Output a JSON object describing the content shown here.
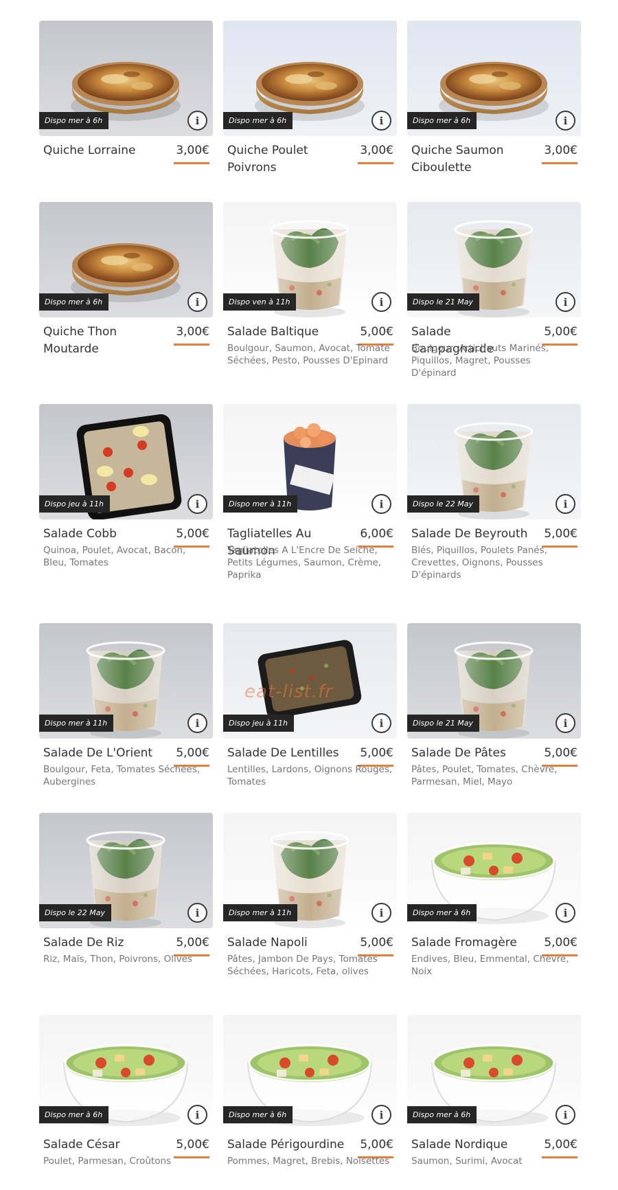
{
  "accent_color": "#e0803d",
  "info_icon": "info-circle-icon",
  "watermark": "eat-list.fr",
  "products": [
    {
      "badge": "Dispo mer à 6h",
      "name": "Quiche Lorraine",
      "price": "3,00€",
      "desc": ""
    },
    {
      "badge": "Dispo mer à 6h",
      "name": "Quiche Poulet Poivrons",
      "price": "3,00€",
      "desc": ""
    },
    {
      "badge": "Dispo mer à 6h",
      "name": "Quiche Saumon Ciboulette",
      "price": "3,00€",
      "desc": ""
    },
    {
      "badge": "Dispo mer à 6h",
      "name": "Quiche Thon Moutarde",
      "price": "3,00€",
      "desc": ""
    },
    {
      "badge": "Dispo ven à 11h",
      "name": "Salade Baltique",
      "price": "5,00€",
      "desc": "Boulgour, Saumon, Avocat, Tomate Séchées, Pesto, Pousses D'Epinard"
    },
    {
      "badge": "Dispo le 21 May",
      "name": "Salade Campagnarde",
      "price": "5,00€",
      "desc": "Boulgour, Artichauts Marinés, Piquillos, Magret, Pousses D'épinard"
    },
    {
      "badge": "Dispo jeu à 11h",
      "name": "Salade Cobb",
      "price": "5,00€",
      "desc": "Quinoa, Poulet, Avocat, Bacon, Bleu, Tomates"
    },
    {
      "badge": "Dispo mer à 11h",
      "name": "Tagliatelles Au Saumon",
      "price": "6,00€",
      "desc": "Tagliatelles A L'Encre De Seiche, Petits Légumes, Saumon, Crème, Paprika"
    },
    {
      "badge": "Dispo le 22 May",
      "name": "Salade De Beyrouth",
      "price": "5,00€",
      "desc": "Blés, Piquillos, Poulets Panés, Crevettes, Oignons, Pousses D'épinards"
    },
    {
      "badge": "Dispo mer à 11h",
      "name": "Salade De L'Orient",
      "price": "5,00€",
      "desc": "Boulgour, Feta, Tomates Séchées, Aubergines"
    },
    {
      "badge": "Dispo jeu à 11h",
      "name": "Salade De Lentilles",
      "price": "5,00€",
      "desc": "Lentilles, Lardons, Oignons Rouges, Tomates"
    },
    {
      "badge": "Dispo le 21 May",
      "name": "Salade De Pâtes",
      "price": "5,00€",
      "desc": "Pâtes, Poulet, Tomates, Chèvre, Parmesan, Miel, Mayo"
    },
    {
      "badge": "Dispo le 22 May",
      "name": "Salade De Riz",
      "price": "5,00€",
      "desc": "Riz, Maïs, Thon, Poivrons, Olives"
    },
    {
      "badge": "Dispo mer à 11h",
      "name": "Salade Napoli",
      "price": "5,00€",
      "desc": "Pâtes, Jambon De Pays, Tomates Séchées, Haricots, Feta, olives"
    },
    {
      "badge": "Dispo mer à 6h",
      "name": "Salade Fromagère",
      "price": "5,00€",
      "desc": "Endives, Bleu, Emmental, Chèvre, Noix"
    },
    {
      "badge": "Dispo mer à 6h",
      "name": "Salade César",
      "price": "5,00€",
      "desc": "Poulet, Parmesan, Croûtons"
    },
    {
      "badge": "Dispo mer à 6h",
      "name": "Salade Périgourdine",
      "price": "5,00€",
      "desc": "Pommes, Magret, Brebis, Noisettes"
    },
    {
      "badge": "Dispo mer à 6h",
      "name": "Salade Nordique",
      "price": "5,00€",
      "desc": "Saumon, Surimi, Avocat"
    }
  ]
}
